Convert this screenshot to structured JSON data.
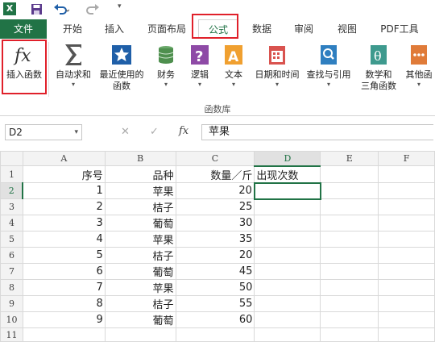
{
  "app": {
    "logo": "X"
  },
  "tabs": [
    {
      "label": "文件"
    },
    {
      "label": "开始"
    },
    {
      "label": "插入"
    },
    {
      "label": "页面布局"
    },
    {
      "label": "公式"
    },
    {
      "label": "数据"
    },
    {
      "label": "审阅"
    },
    {
      "label": "视图"
    },
    {
      "label": "PDF工具"
    }
  ],
  "ribbon": {
    "buttons": [
      {
        "label": "插入函数",
        "icon": "fx-icon"
      },
      {
        "label": "自动求和",
        "icon": "sigma-icon"
      },
      {
        "label": "最近使用的\n函数",
        "icon": "star-icon"
      },
      {
        "label": "财务",
        "icon": "coins-icon"
      },
      {
        "label": "逻辑",
        "icon": "question-icon"
      },
      {
        "label": "文本",
        "icon": "text-icon"
      },
      {
        "label": "日期和时间",
        "icon": "calendar-icon"
      },
      {
        "label": "查找与引用",
        "icon": "search-icon"
      },
      {
        "label": "数学和\n三角函数",
        "icon": "theta-icon"
      },
      {
        "label": "其他函",
        "icon": "more-functions-icon"
      }
    ],
    "group_label": "函数库"
  },
  "formula_bar": {
    "name_box": "D2",
    "cancel": "✕",
    "enter": "✓",
    "fx": "fx",
    "content": "苹果"
  },
  "sheet": {
    "columns": [
      "A",
      "B",
      "C",
      "D",
      "E",
      "F"
    ],
    "rows": [
      {
        "n": "1",
        "a": "序号",
        "b": "品种",
        "c": "数量／斤",
        "d": "出现次数"
      },
      {
        "n": "2",
        "a": "1",
        "b": "苹果",
        "c": "20",
        "d": ""
      },
      {
        "n": "3",
        "a": "2",
        "b": "桔子",
        "c": "25",
        "d": ""
      },
      {
        "n": "4",
        "a": "3",
        "b": "葡萄",
        "c": "30",
        "d": ""
      },
      {
        "n": "5",
        "a": "4",
        "b": "苹果",
        "c": "35",
        "d": ""
      },
      {
        "n": "6",
        "a": "5",
        "b": "桔子",
        "c": "20",
        "d": ""
      },
      {
        "n": "7",
        "a": "6",
        "b": "葡萄",
        "c": "45",
        "d": ""
      },
      {
        "n": "8",
        "a": "7",
        "b": "苹果",
        "c": "50",
        "d": ""
      },
      {
        "n": "9",
        "a": "8",
        "b": "桔子",
        "c": "55",
        "d": ""
      },
      {
        "n": "10",
        "a": "9",
        "b": "葡萄",
        "c": "60",
        "d": ""
      },
      {
        "n": "11",
        "a": "",
        "b": "",
        "c": "",
        "d": ""
      }
    ]
  },
  "colors": {
    "accent": "#217346",
    "highlight": "#e0202a"
  }
}
